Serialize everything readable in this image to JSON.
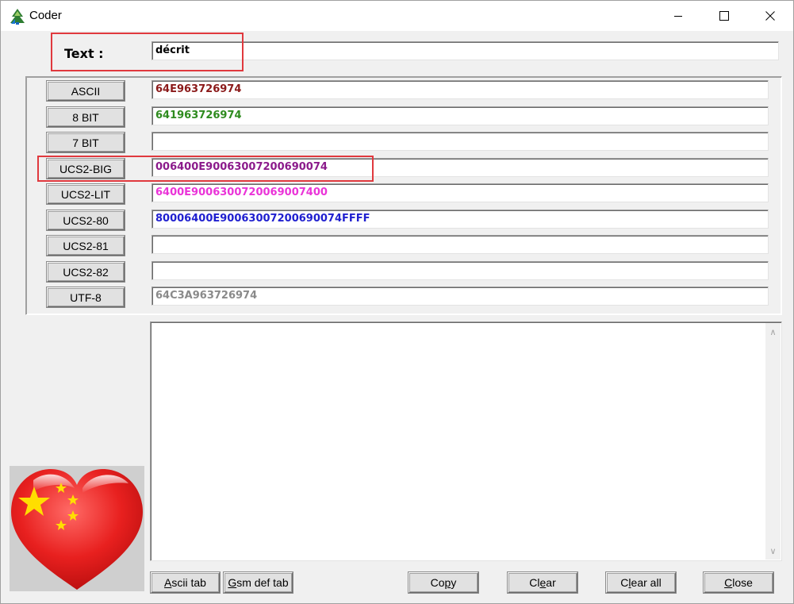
{
  "window": {
    "title": "Coder"
  },
  "text_input": {
    "label": "Text :",
    "value": "décrit"
  },
  "encodings": [
    {
      "label": "ASCII",
      "value": "64E963726974",
      "color": "#8b1a1a"
    },
    {
      "label": "8 BIT",
      "value": "641963726974",
      "color": "#2e8b1e"
    },
    {
      "label": "7 BIT",
      "value": "",
      "color": "#000000"
    },
    {
      "label": "UCS2-BIG",
      "value": "006400E90063007200690074",
      "color": "#8b1a8b"
    },
    {
      "label": "UCS2-LIT",
      "value": "6400E9006300720069007400",
      "color": "#ea33d8"
    },
    {
      "label": "UCS2-80",
      "value": "80006400E90063007200690074FFFF",
      "color": "#1f1fcf"
    },
    {
      "label": "UCS2-81",
      "value": "",
      "color": "#000000"
    },
    {
      "label": "UCS2-82",
      "value": "",
      "color": "#000000"
    },
    {
      "label": "UTF-8",
      "value": "64C3A963726974",
      "color": "#8a8a8a"
    }
  ],
  "memo": {
    "value": ""
  },
  "buttons": {
    "ascii_tab": {
      "hotkey": "A",
      "rest": "scii tab"
    },
    "gsm_def_tab": {
      "hotkey": "G",
      "rest": "sm def tab"
    },
    "copy": {
      "pre": "Co",
      "hotkey": "p",
      "rest": "y"
    },
    "clear": {
      "pre": "Cl",
      "hotkey": "e",
      "rest": "ar"
    },
    "clear_all": {
      "pre": "C",
      "hotkey": "l",
      "rest": "ear all"
    },
    "close": {
      "pre": "",
      "hotkey": "C",
      "rest": "lose"
    }
  },
  "colors": {
    "highlight": "#e0393e",
    "flag_red": "#e8201f",
    "flag_star": "#ffde00"
  },
  "icons": {
    "app": "tree-icon",
    "flag": "china-flag-heart-icon"
  }
}
